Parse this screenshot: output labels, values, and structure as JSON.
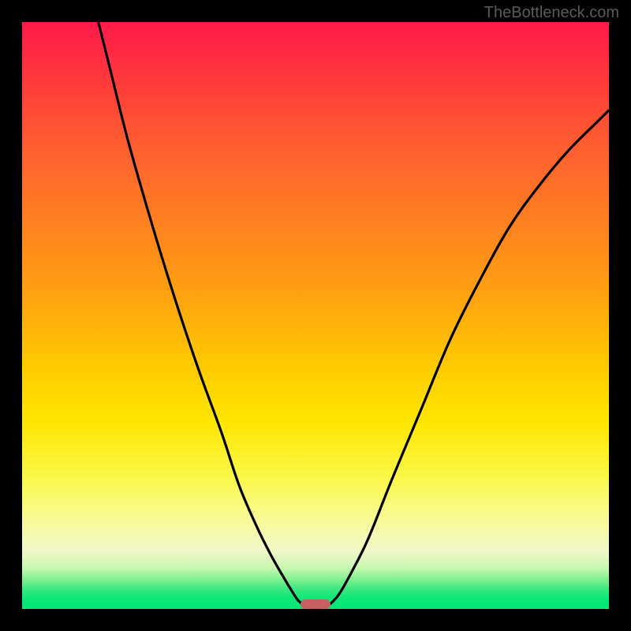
{
  "watermark": "TheBottleneck.com",
  "chart_data": {
    "type": "line",
    "title": "",
    "xlabel": "",
    "ylabel": "",
    "xlim": [
      0,
      100
    ],
    "ylim": [
      0,
      100
    ],
    "series": [
      {
        "name": "left-curve",
        "x": [
          13,
          15,
          18,
          22,
          26,
          30,
          34,
          37,
          40,
          42.5,
          44.5,
          46,
          47,
          47.8
        ],
        "values": [
          100,
          92,
          80,
          66,
          53,
          41,
          30,
          21,
          14,
          9,
          5.5,
          3,
          1.5,
          0.8
        ]
      },
      {
        "name": "right-curve",
        "x": [
          52.5,
          54,
          56,
          59,
          63,
          68,
          73,
          78,
          83,
          88,
          93,
          98,
          100
        ],
        "values": [
          0.8,
          2.5,
          6,
          12,
          22,
          34,
          46,
          56,
          65,
          72,
          78,
          83,
          85
        ]
      }
    ],
    "marker": {
      "x_center": 50,
      "y": 0.8,
      "width_pct": 5,
      "color": "#c76065"
    },
    "gradient": {
      "top": "#ff1a4a",
      "mid": "#ffe600",
      "bottom": "#00e878"
    }
  }
}
